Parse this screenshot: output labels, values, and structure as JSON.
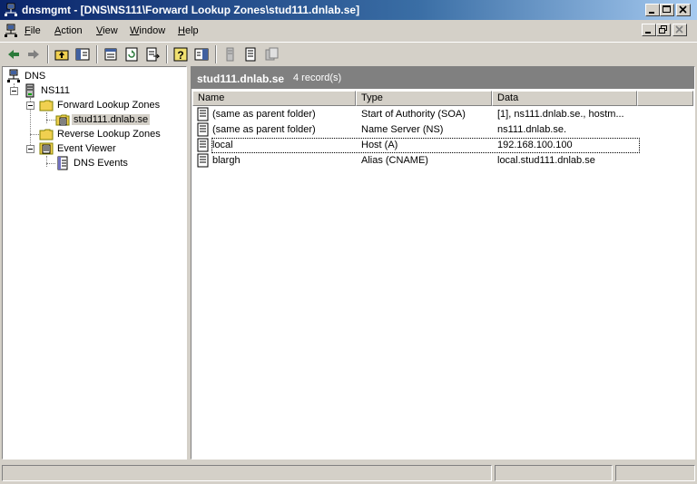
{
  "window": {
    "title": "dnsmgmt - [DNS\\NS111\\Forward Lookup Zones\\stud111.dnlab.se]"
  },
  "menu": [
    {
      "label": "File",
      "accel": "F",
      "rest": "ile"
    },
    {
      "label": "Action",
      "accel": "A",
      "rest": "ction"
    },
    {
      "label": "View",
      "accel": "V",
      "rest": "iew"
    },
    {
      "label": "Window",
      "accel": "W",
      "rest": "indow"
    },
    {
      "label": "Help",
      "accel": "H",
      "rest": "elp"
    }
  ],
  "tree": {
    "root": "DNS",
    "server": "NS111",
    "forward_zones": "Forward Lookup Zones",
    "zone": "stud111.dnlab.se",
    "reverse_zones": "Reverse Lookup Zones",
    "event_viewer": "Event Viewer",
    "dns_events": "DNS Events"
  },
  "list": {
    "title": "stud111.dnlab.se",
    "count": "4 record(s)",
    "columns": {
      "name": "Name",
      "type": "Type",
      "data": "Data"
    },
    "rows": [
      {
        "name": "(same as parent folder)",
        "type": "Start of Authority (SOA)",
        "data": "[1], ns111.dnlab.se., hostm..."
      },
      {
        "name": "(same as parent folder)",
        "type": "Name Server (NS)",
        "data": "ns111.dnlab.se."
      },
      {
        "name": "local",
        "type": "Host (A)",
        "data": "192.168.100.100"
      },
      {
        "name": "blargh",
        "type": "Alias (CNAME)",
        "data": "local.stud111.dnlab.se"
      }
    ]
  },
  "colors": {
    "title_start": "#0a246a",
    "title_end": "#a6caf0",
    "face": "#d4d0c8",
    "pane_header": "#808080"
  }
}
